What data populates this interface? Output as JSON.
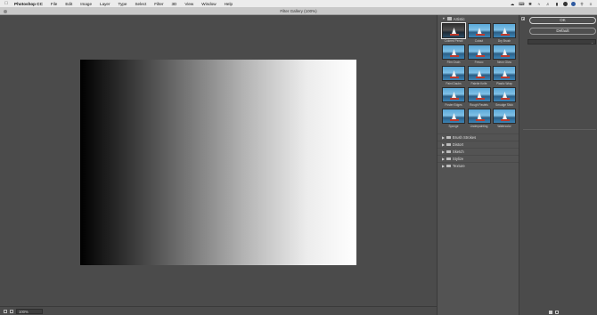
{
  "menubar": {
    "items": [
      "Photoshop CC",
      "File",
      "Edit",
      "Image",
      "Layer",
      "Type",
      "Select",
      "Filter",
      "3D",
      "View",
      "Window",
      "Help"
    ]
  },
  "window": {
    "title": "Filter Gallery (100%)"
  },
  "statusbar": {
    "zoom": "100%"
  },
  "filter_browser": {
    "open_category": "Artistic",
    "artistic_filters": [
      "Colored Pencil",
      "Cutout",
      "Dry Brush",
      "Film Grain",
      "Fresco",
      "Neon Glow",
      "Paint Daubs",
      "Palette Knife",
      "Plastic Wrap",
      "Poster Edges",
      "Rough Pastels",
      "Smudge Stick",
      "Sponge",
      "Underpainting",
      "Watercolor"
    ],
    "selected_filter": "Colored Pencil",
    "other_categories": [
      "Brush Strokes",
      "Distort",
      "Sketch",
      "Stylize",
      "Texture"
    ]
  },
  "settings": {
    "ok_label": "OK",
    "default_label": "Default",
    "filter_select_value": ""
  },
  "colors": {
    "panel_bg": "#535353",
    "workspace_bg": "#4b4b4b",
    "menubar_bg": "#ececec"
  }
}
